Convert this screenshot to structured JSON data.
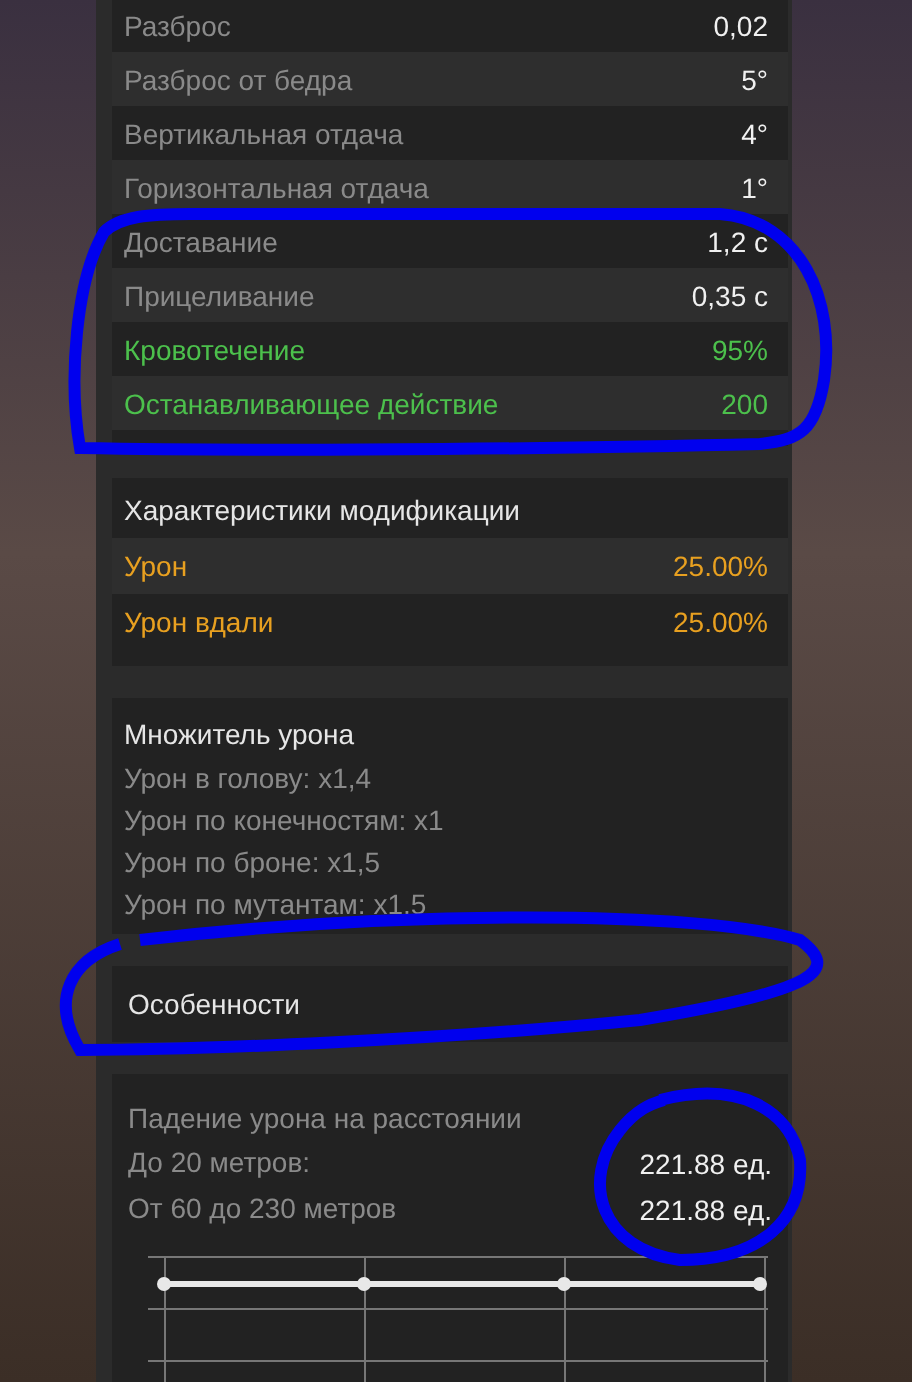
{
  "stats": [
    {
      "label": "Разброс",
      "value": "0,02",
      "kind": "normal"
    },
    {
      "label": "Разброс от бедра",
      "value": "5°",
      "kind": "normal"
    },
    {
      "label": "Вертикальная отдача",
      "value": "4°",
      "kind": "normal"
    },
    {
      "label": "Горизонтальная отдача",
      "value": "1°",
      "kind": "normal"
    },
    {
      "label": "Доставание",
      "value": "1,2 с",
      "kind": "normal"
    },
    {
      "label": "Прицеливание",
      "value": "0,35 с",
      "kind": "normal"
    },
    {
      "label": "Кровотечение",
      "value": "95%",
      "kind": "positive"
    },
    {
      "label": "Останавливающее действие",
      "value": "200",
      "kind": "positive"
    }
  ],
  "modifications": {
    "title": "Характеристики модификации",
    "rows": [
      {
        "label": "Урон",
        "value": "25.00%"
      },
      {
        "label": "Урон вдали",
        "value": "25.00%"
      }
    ]
  },
  "multiplier": {
    "title": "Множитель урона",
    "lines": [
      "Урон в голову: x1,4",
      "Урон по конечностям: x1",
      "Урон по броне: x1,5",
      "Урон по мутантам: x1,5"
    ]
  },
  "features": {
    "title": "Особенности"
  },
  "falloff": {
    "title": "Падение урона на расстоянии",
    "rows": [
      {
        "label": "До 20 метров:",
        "value": "221.88 ед."
      },
      {
        "label": "От 60 до 230 метров",
        "value": "221.88 ед."
      }
    ]
  }
}
